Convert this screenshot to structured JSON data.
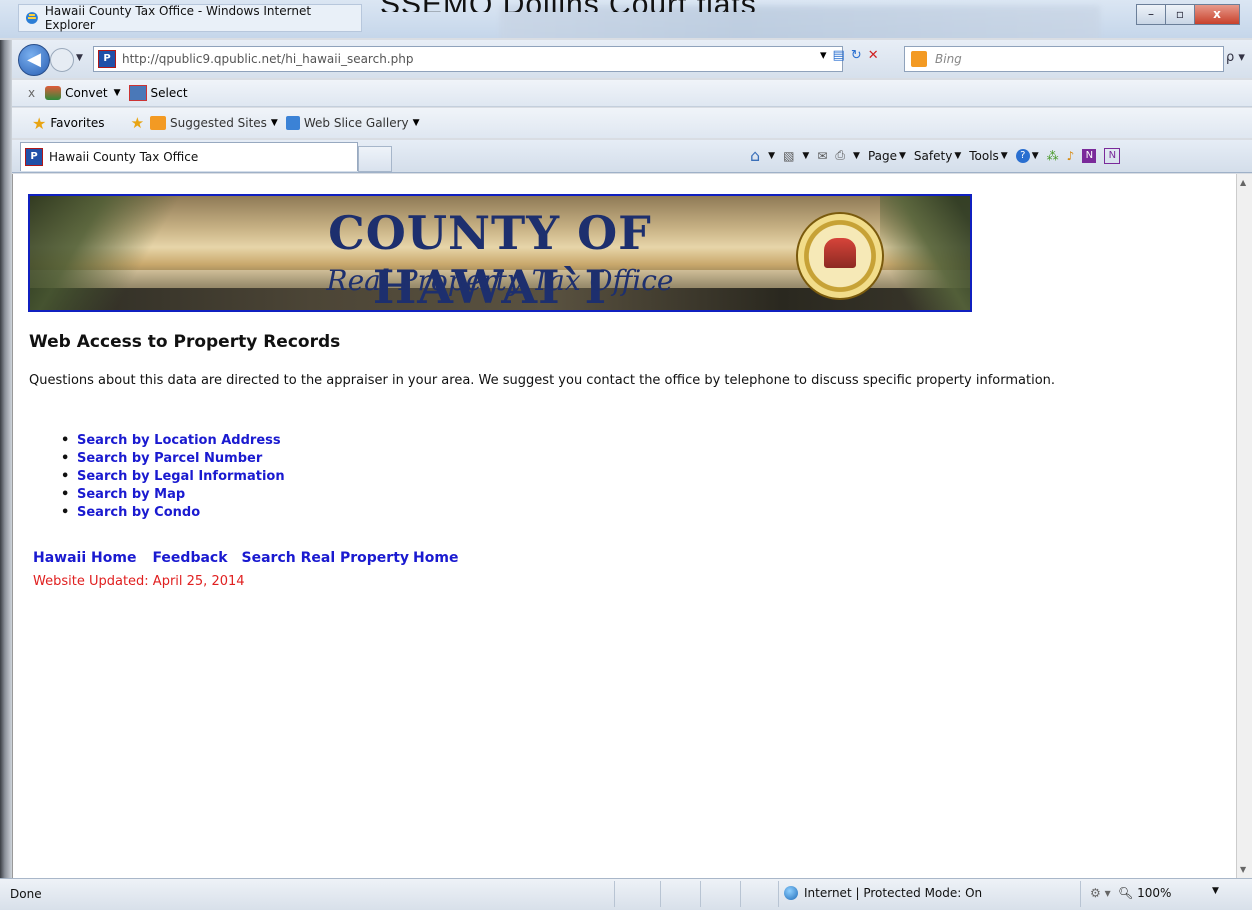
{
  "window": {
    "title": "Hawaii County Tax Office - Windows Internet Explorer",
    "overlay_text": "SSEMQ Dollins Court flats innovalmitted to Municipal",
    "minimize": "–",
    "maximize": "▫",
    "close": "x"
  },
  "addressbar": {
    "back": "◀",
    "url": "http://qpublic9.qpublic.net/hi_hawaii_search.php",
    "search_placeholder": "Bing",
    "search_go": "ρ ▾"
  },
  "commandbar": {
    "close": "x",
    "convert": "Convet",
    "select": "Select"
  },
  "favorites": {
    "favorites": "Favorites",
    "suggested": "Suggested Sites",
    "webslice": "Web Slice Gallery"
  },
  "tabs": {
    "active_label": "Hawaii County Tax Office"
  },
  "toolbar": {
    "page": "Page",
    "safety": "Safety",
    "tools": "Tools"
  },
  "banner": {
    "title": "COUNTY OF HAWAI`I",
    "subtitle": "Real Property Tax Office"
  },
  "content": {
    "heading": "Web Access to Property Records",
    "intro": "Questions about this data are directed to the appraiser in your area.  We suggest you contact the office by telephone to discuss specific property information.",
    "links": [
      "Search by Location Address",
      "Search by Parcel Number",
      "Search by Legal Information",
      "Search by Map",
      "Search by Condo"
    ],
    "footer_links": [
      "Hawaii Home",
      "Feedback",
      "Search Real Property",
      "Home"
    ],
    "updated": "Website Updated: April 25, 2014"
  },
  "statusbar": {
    "left": "Done",
    "zone": "Internet | Protected Mode: On",
    "zoom": "100%"
  },
  "colors": {
    "link": "#1a1ad0",
    "updated": "#e02020",
    "banner_border": "#1020c0",
    "banner_text": "#1d2f6e"
  },
  "icons": [
    "ie-icon",
    "back-icon",
    "forward-icon",
    "favicon-p-icon",
    "compat-icon",
    "refresh-icon",
    "stop-icon",
    "bing-icon",
    "search-icon",
    "star-icon",
    "home-icon",
    "feeds-icon",
    "mail-icon",
    "print-icon",
    "help-icon",
    "globe-icon"
  ]
}
